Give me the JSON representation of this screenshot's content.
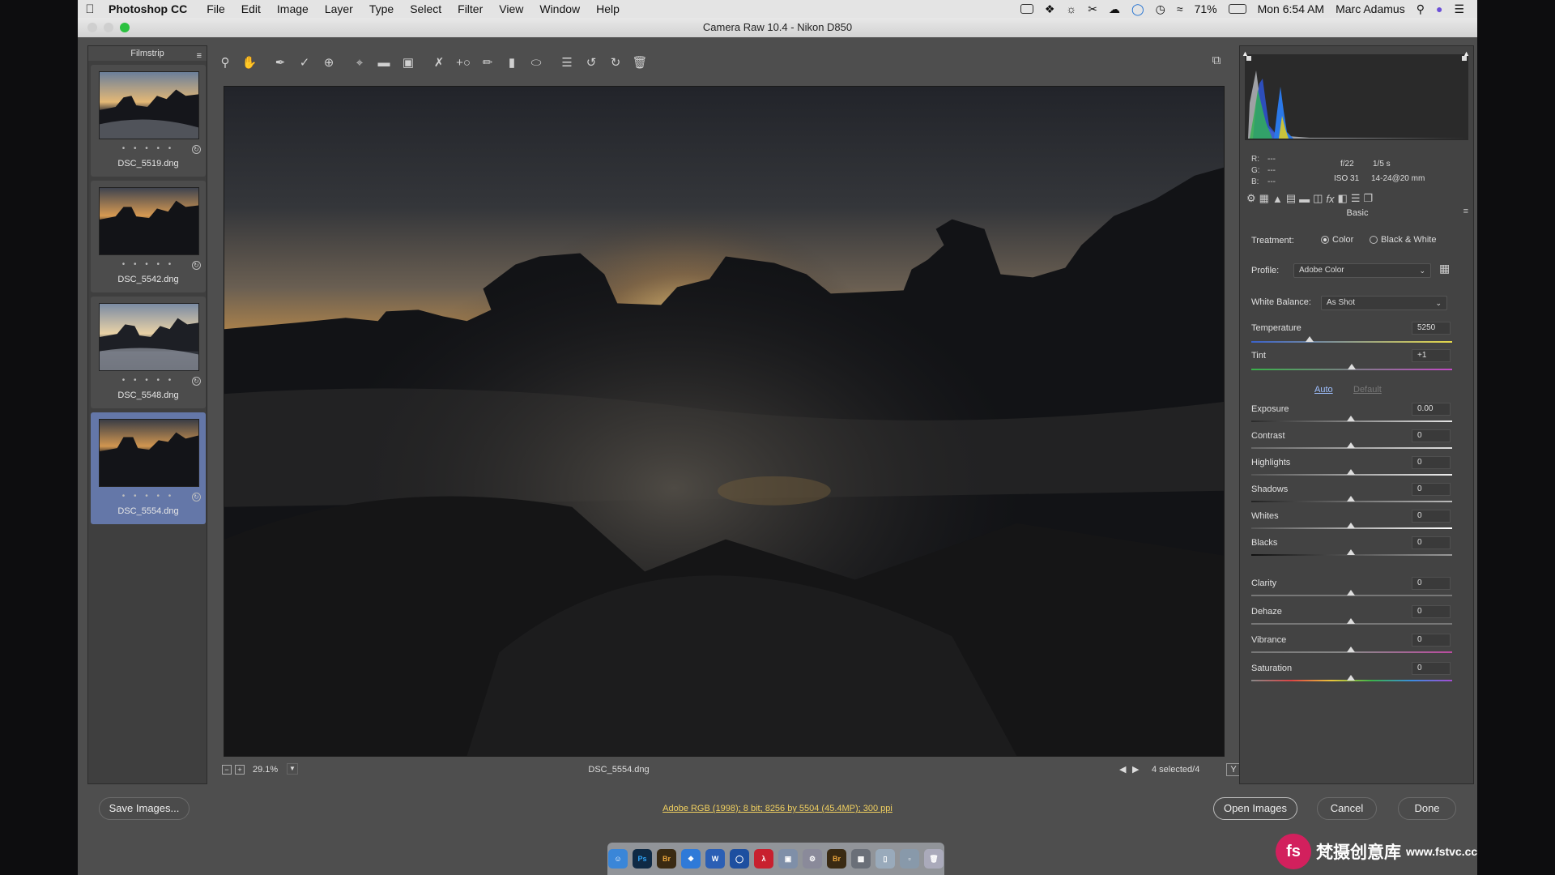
{
  "menubar": {
    "app_name": "Photoshop CC",
    "items": [
      "File",
      "Edit",
      "Image",
      "Layer",
      "Type",
      "Select",
      "Filter",
      "View",
      "Window",
      "Help"
    ],
    "battery": "71%",
    "clock": "Mon 6:54 AM",
    "user": "Marc Adamus"
  },
  "window": {
    "title": "Camera Raw 10.4  -  Nikon D850"
  },
  "filmstrip": {
    "title": "Filmstrip",
    "items": [
      {
        "name": "DSC_5519.dng",
        "stars": "• • • • •"
      },
      {
        "name": "DSC_5542.dng",
        "stars": "• • • • •"
      },
      {
        "name": "DSC_5548.dng",
        "stars": "• • • • •"
      },
      {
        "name": "DSC_5554.dng",
        "stars": "• • • • •",
        "selected": true
      }
    ]
  },
  "toolbar": {
    "tools": [
      "zoom-icon",
      "hand-icon",
      "white-balance-icon",
      "color-sampler-icon",
      "targeted-adjust-icon",
      "crop-icon",
      "straighten-icon",
      "transform-icon",
      "spot-removal-icon",
      "red-eye-icon",
      "adjustment-brush-icon",
      "graduated-filter-icon",
      "radial-filter-icon",
      "preferences-icon",
      "rotate-left-icon",
      "rotate-right-icon",
      "trash-icon"
    ]
  },
  "status": {
    "zoom": "29.1%",
    "filename": "DSC_5554.dng",
    "selection": "4 selected/4"
  },
  "info": {
    "r_label": "R:",
    "g_label": "G:",
    "b_label": "B:",
    "r_val": "---",
    "g_val": "---",
    "b_val": "---",
    "aperture": "f/22",
    "shutter": "1/5 s",
    "iso": "ISO 31",
    "lens": "14-24@20 mm"
  },
  "basic": {
    "title": "Basic",
    "treatment_label": "Treatment:",
    "treatment_color": "Color",
    "treatment_bw": "Black & White",
    "profile_label": "Profile:",
    "profile_value": "Adobe Color",
    "wb_label": "White Balance:",
    "wb_value": "As Shot",
    "auto": "Auto",
    "default": "Default",
    "temperature": {
      "label": "Temperature",
      "value": "5250"
    },
    "tint": {
      "label": "Tint",
      "value": "+1"
    },
    "exposure": {
      "label": "Exposure",
      "value": "0.00"
    },
    "contrast": {
      "label": "Contrast",
      "value": "0"
    },
    "highlights": {
      "label": "Highlights",
      "value": "0"
    },
    "shadows": {
      "label": "Shadows",
      "value": "0"
    },
    "whites": {
      "label": "Whites",
      "value": "0"
    },
    "blacks": {
      "label": "Blacks",
      "value": "0"
    },
    "clarity": {
      "label": "Clarity",
      "value": "0"
    },
    "dehaze": {
      "label": "Dehaze",
      "value": "0"
    },
    "vibrance": {
      "label": "Vibrance",
      "value": "0"
    },
    "saturation": {
      "label": "Saturation",
      "value": "0"
    }
  },
  "footer": {
    "save_images": "Save Images...",
    "workflow": "Adobe RGB (1998); 8 bit; 8256 by 5504 (45.4MP); 300 ppi",
    "open_images": "Open Images",
    "cancel": "Cancel",
    "done": "Done"
  },
  "dock": {
    "items": [
      "Ps",
      "Br",
      "W",
      "Br"
    ]
  },
  "watermark": {
    "logo": "fs",
    "cn": "梵摄创意库",
    "url": "www.fstvc.cc"
  },
  "colors": {
    "link": "#f1d060",
    "selection": "#6477a8"
  }
}
